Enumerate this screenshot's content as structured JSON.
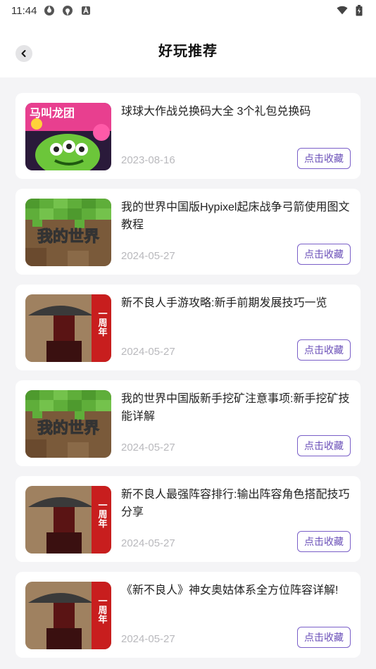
{
  "status_bar": {
    "time": "11:44"
  },
  "header": {
    "title": "好玩推荐"
  },
  "articles": [
    {
      "title": "球球大作战兑换码大全 3个礼包兑换码",
      "date": "2023-08-16",
      "button": "点击收藏",
      "thumb": "qiuqiu"
    },
    {
      "title": "我的世界中国版Hypixel起床战争弓箭使用图文教程",
      "date": "2024-05-27",
      "button": "点击收藏",
      "thumb": "minecraft"
    },
    {
      "title": "新不良人手游攻略:新手前期发展技巧一览",
      "date": "2024-05-27",
      "button": "点击收藏",
      "thumb": "buliangren"
    },
    {
      "title": "我的世界中国版新手挖矿注意事项:新手挖矿技能详解",
      "date": "2024-05-27",
      "button": "点击收藏",
      "thumb": "minecraft"
    },
    {
      "title": "新不良人最强阵容排行:输出阵容角色搭配技巧分享",
      "date": "2024-05-27",
      "button": "点击收藏",
      "thumb": "buliangren"
    },
    {
      "title": "《新不良人》神女奥姑体系全方位阵容详解!",
      "date": "2024-05-27",
      "button": "点击收藏",
      "thumb": "buliangren"
    }
  ],
  "thumb_text": {
    "qiuqiu": "马叫龙团",
    "minecraft": "我的世界",
    "buliangren": "一周年"
  },
  "colors": {
    "accent": "#6a4fb8",
    "date": "#b9b9bd",
    "background": "#f4f4f6"
  }
}
